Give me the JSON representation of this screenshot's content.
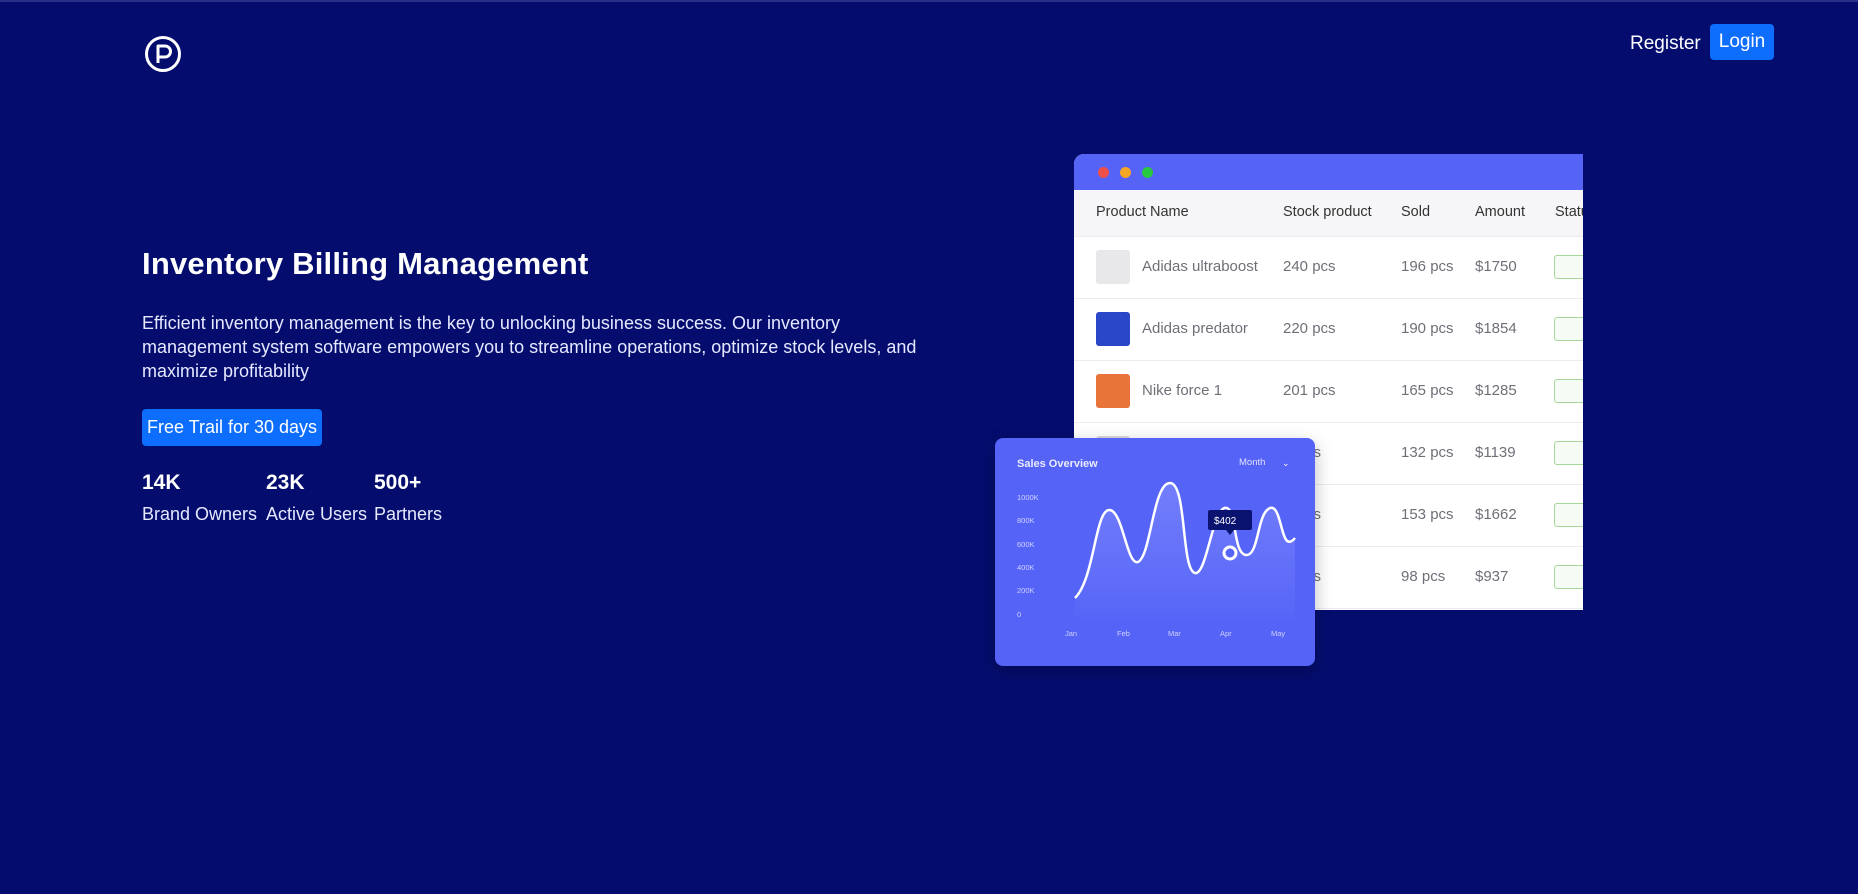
{
  "nav": {
    "logo_icon": "p-circle-logo-icon",
    "register_label": "Register",
    "login_label": "Login"
  },
  "hero": {
    "title": "Inventory Billing Management",
    "description": "Efficient inventory management is the key to unlocking business success. Our inventory management system software empowers you to streamline operations, optimize stock levels, and maximize profitability",
    "cta_label": "Free Trail for 30 days",
    "stats": [
      {
        "value": "14K",
        "label": "Brand Owners"
      },
      {
        "value": "23K",
        "label": "Active Users"
      },
      {
        "value": "500+",
        "label": "Partners"
      }
    ]
  },
  "table_mockup": {
    "columns": [
      "Product Name",
      "Stock product",
      "Sold",
      "Amount",
      "Statu"
    ],
    "rows": [
      {
        "name": "Adidas ultraboost",
        "stock": "240 pcs",
        "sold": "196 pcs",
        "amount": "$1750",
        "thumb_color": "#e8e8ea"
      },
      {
        "name": "Adidas predator",
        "stock": "220 pcs",
        "sold": "190 pcs",
        "amount": "$1854",
        "thumb_color": "#2a46c9"
      },
      {
        "name": "Nike force 1",
        "stock": "201 pcs",
        "sold": "165 pcs",
        "amount": "$1285",
        "thumb_color": "#e9743a"
      },
      {
        "name": "",
        "stock": "cs",
        "sold": "132 pcs",
        "amount": "$1139",
        "thumb_color": "#d9d9dc"
      },
      {
        "name": "",
        "stock": "cs",
        "sold": "153 pcs",
        "amount": "$1662",
        "thumb_color": "#d9d9dc"
      },
      {
        "name": "",
        "stock": "cs",
        "sold": "98 pcs",
        "amount": "$937",
        "thumb_color": "#d9d9dc"
      }
    ],
    "window_dots": [
      "#f0504a",
      "#f5a623",
      "#28c840"
    ]
  },
  "sales_card": {
    "title": "Sales Overview",
    "period": "Month",
    "tooltip": "$402",
    "y_ticks": [
      "1000K",
      "800K",
      "600K",
      "400K",
      "200K",
      "0"
    ],
    "x_ticks": [
      "Jan",
      "Feb",
      "Mar",
      "Apr",
      "May"
    ]
  },
  "colors": {
    "background": "#040d6e",
    "accent_button": "#0d6efd",
    "card_blue": "#5563f7"
  }
}
